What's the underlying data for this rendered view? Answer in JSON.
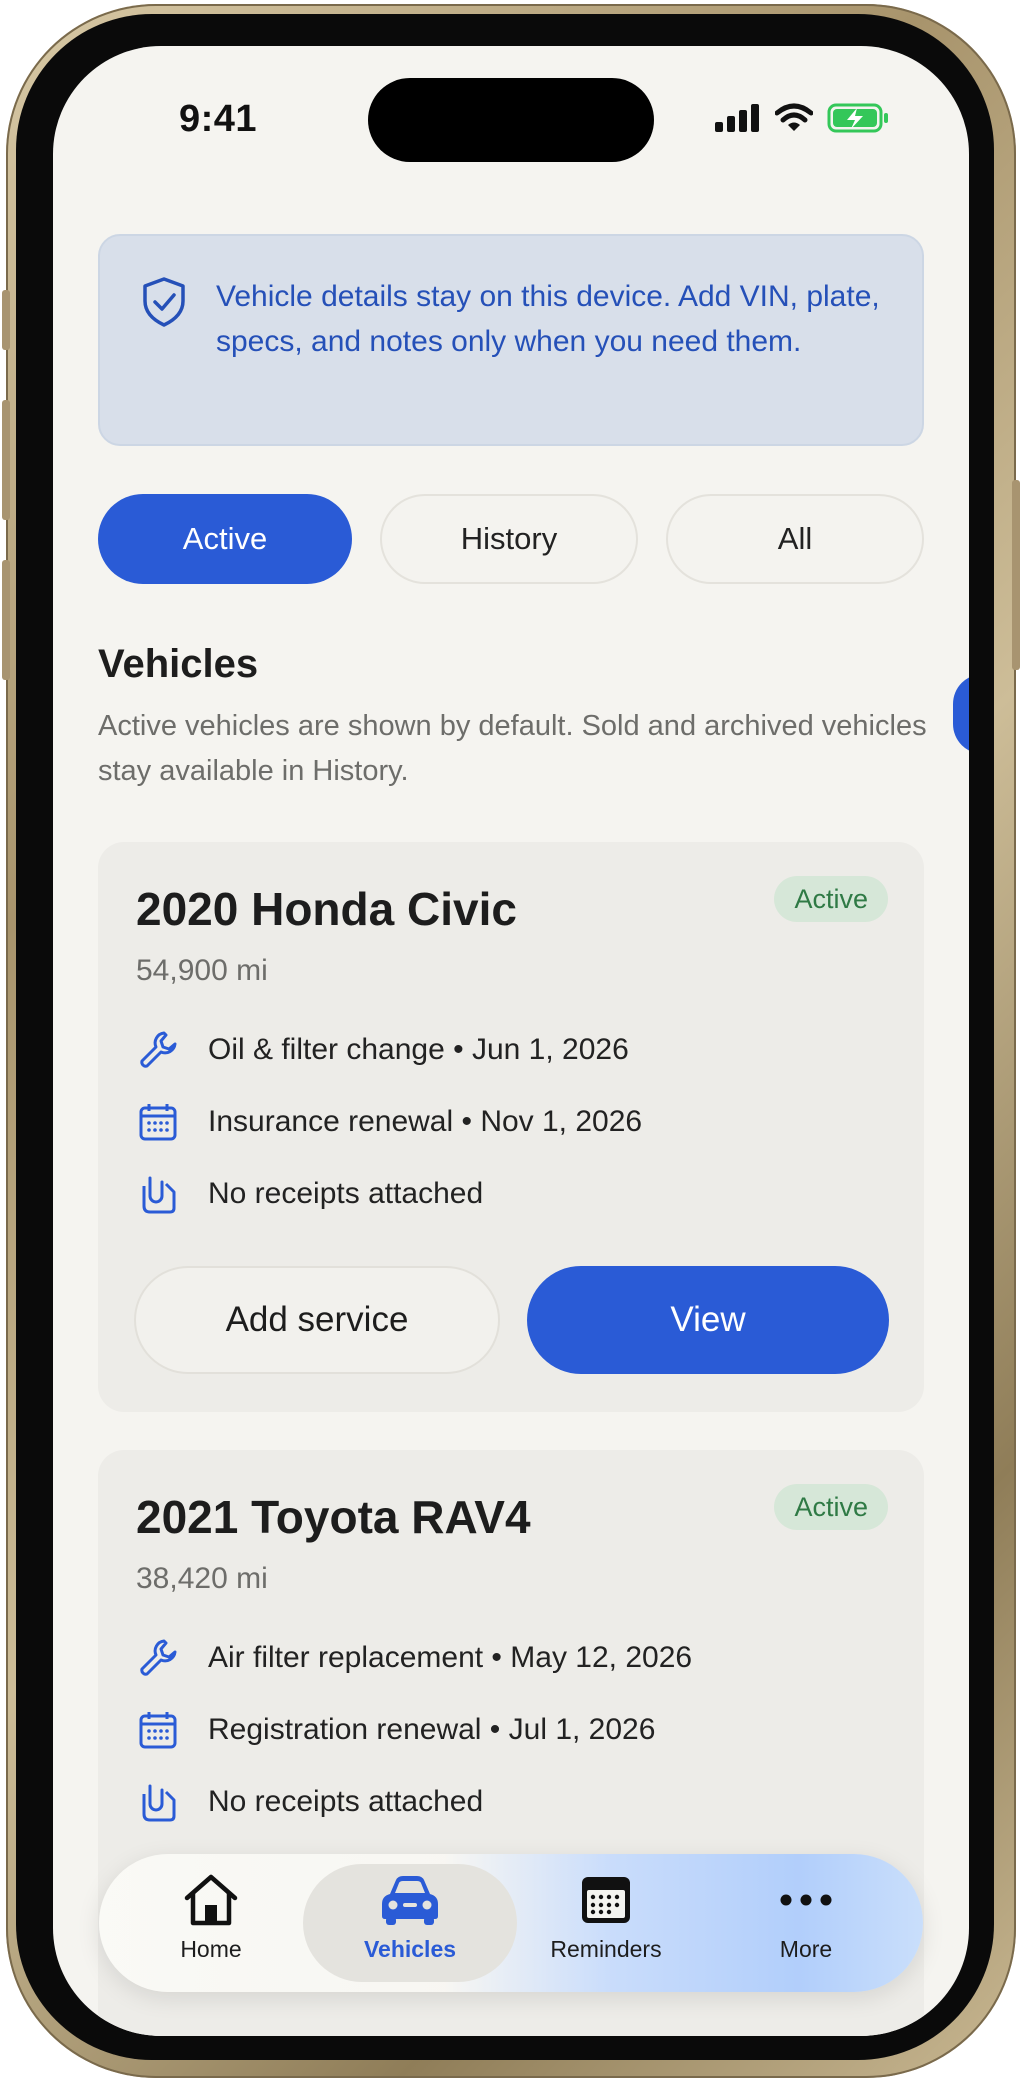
{
  "status": {
    "time": "9:41"
  },
  "notice": {
    "text": "Vehicle details stay on this device. Add VIN, plate, specs, and notes only when you need them."
  },
  "filters": {
    "active": "Active",
    "history": "History",
    "all": "All",
    "selected": "Active"
  },
  "section": {
    "title": "Vehicles",
    "subtitle": "Active vehicles are shown by default. Sold and archived vehicles stay available in History."
  },
  "vehicles": [
    {
      "title": "2020 Honda Civic",
      "badge": "Active",
      "miles": "54,900 mi",
      "service": "Oil & filter change • Jun 1, 2026",
      "reminder": "Insurance renewal • Nov 1, 2026",
      "receipts": "No receipts attached",
      "add_label": "Add service",
      "view_label": "View"
    },
    {
      "title": "2021 Toyota RAV4",
      "badge": "Active",
      "miles": "38,420 mi",
      "service": "Air filter replacement • May 12, 2026",
      "reminder": "Registration renewal • Jul 1, 2026",
      "receipts": "No receipts attached"
    }
  ],
  "tabs": {
    "home": "Home",
    "vehicles": "Vehicles",
    "reminders": "Reminders",
    "more": "More",
    "selected": "Vehicles"
  },
  "icons": {
    "notice": "shield-check-icon",
    "service": "wrench-icon",
    "reminder": "calendar-icon",
    "receipts": "paperclip-icon",
    "home": "house-icon",
    "vehicles": "car-icon",
    "reminders_tab": "calendar-icon",
    "more": "ellipsis-icon"
  },
  "colors": {
    "accent": "#2a5bd6",
    "badge_bg": "#d6e7d8",
    "badge_text": "#2f7a45",
    "notice_bg": "#d8dfea",
    "notice_text": "#2550b8",
    "battery": "#34c759"
  }
}
